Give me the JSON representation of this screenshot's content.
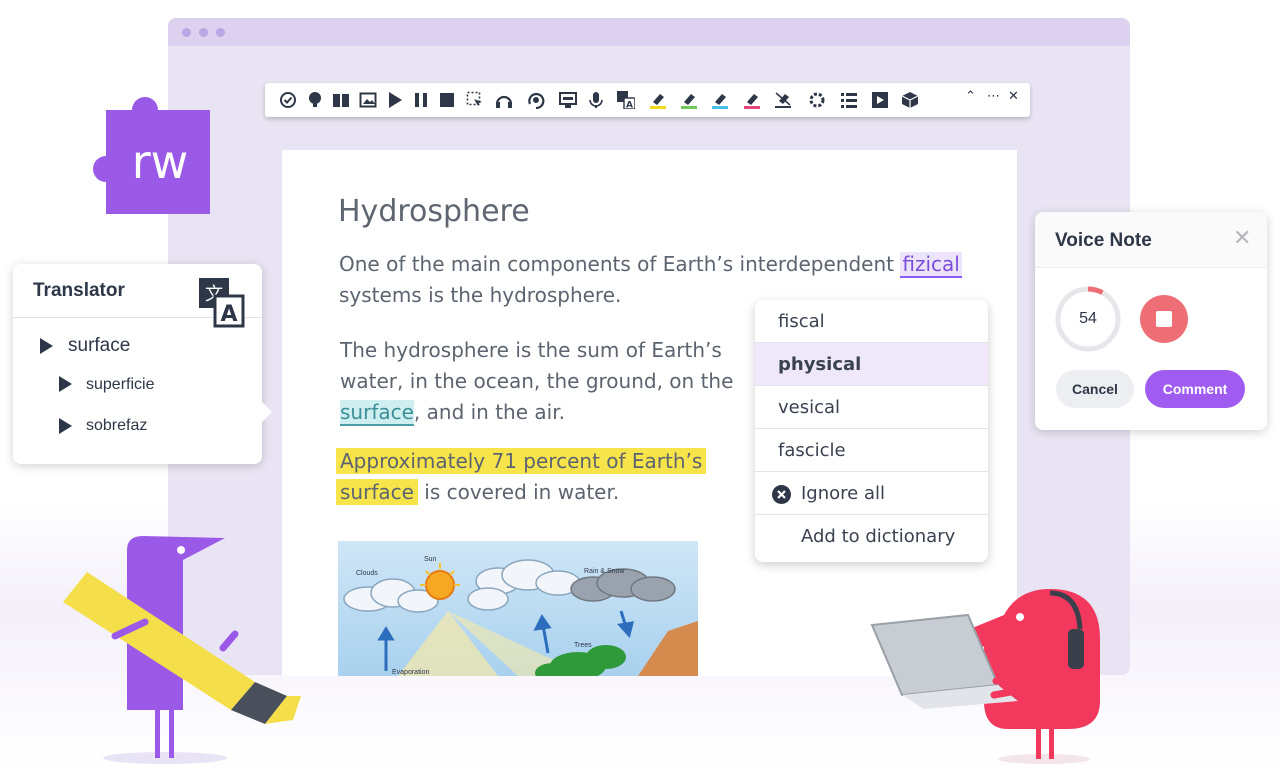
{
  "brand": {
    "logo_text": "rw",
    "color": "#9b59e8"
  },
  "toolbar": {
    "icons": [
      "check-icon",
      "dictionary-icon",
      "book-icon",
      "picture-dictionary-icon",
      "play-icon",
      "pause-icon",
      "stop-icon",
      "screen-select-icon",
      "audio-maker-icon",
      "talk-type-icon",
      "screen-mask-icon",
      "microphone-icon",
      "translate-icon",
      "highlight-yellow-icon",
      "highlight-green-icon",
      "highlight-blue-icon",
      "highlight-pink-icon",
      "clear-highlights-icon",
      "settings-icon",
      "list-icon",
      "video-icon",
      "box-icon"
    ],
    "collapse_symbol": "⌃",
    "more_symbol": "⋯",
    "close_symbol": "✕"
  },
  "document": {
    "title": "Hydrosphere",
    "p1_before": "One of the main components of Earth’s interdependent",
    "p1_misspelled": "fizical",
    "p1_line2": "systems is the hydrosphere.",
    "p2_line1": "The hydrosphere is the sum of Earth’s",
    "p2_line2": "water, in the ocean, the ground, on the",
    "p2_highlight": "surface",
    "p2_after": ", and in the air.",
    "p3_line1": "Approximately 71 percent of Earth’s",
    "p3_highlight2": "surface",
    "p3_after": " is covered in water.",
    "image_labels": {
      "clouds": "Clouds",
      "sun": "Sun",
      "rain": "Rain & Snow",
      "trees": "Trees",
      "evaporation": "Evaporation"
    }
  },
  "spellcheck": {
    "suggestions": [
      "fiscal",
      "physical",
      "vesical",
      "fascicle"
    ],
    "selected_index": 1,
    "ignore_label": "Ignore all",
    "dictionary_label": "Add to dictionary"
  },
  "translator": {
    "title": "Translator",
    "word": "surface",
    "translations": [
      "superficie",
      "sobrefaz"
    ]
  },
  "voice_note": {
    "title": "Voice Note",
    "close_symbol": "✕",
    "countdown": "54",
    "progress_fraction": 0.08,
    "cancel_label": "Cancel",
    "comment_label": "Comment"
  },
  "colors": {
    "accent": "#a05cf0",
    "highlight_yellow": "#f7e34a",
    "highlight_teal": "#cfeef0",
    "record_red": "#ee6e76"
  }
}
